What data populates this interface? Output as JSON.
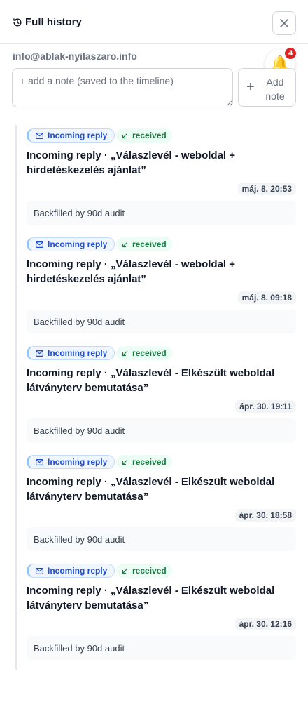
{
  "header": {
    "title": "Full history",
    "icon": "history-icon",
    "close_icon": "close-icon"
  },
  "contact": {
    "email": "info@ablak-nyilaszaro.info"
  },
  "notifications": {
    "count": "4",
    "icon": "bell-icon"
  },
  "note": {
    "placeholder": "+ add a note (saved to the timeline)",
    "add_label": "Add note",
    "add_icon": "plus-icon"
  },
  "entries": [
    {
      "type_label": "Incoming reply",
      "status_label": "received",
      "title": "Incoming reply · „Válaszlevél - weboldal + hirdetéskezelés ajánlat”",
      "time": "máj. 8. 20:53",
      "note": "Backfilled by 90d audit"
    },
    {
      "type_label": "Incoming reply",
      "status_label": "received",
      "title": "Incoming reply · „Válaszlevél - weboldal + hirdetéskezelés ajánlat”",
      "time": "máj. 8. 09:18",
      "note": "Backfilled by 90d audit"
    },
    {
      "type_label": "Incoming reply",
      "status_label": "received",
      "title": "Incoming reply · „Válaszlevél - Elkészült weboldal látványterv bemutatása”",
      "time": "ápr. 30. 19:11",
      "note": "Backfilled by 90d audit"
    },
    {
      "type_label": "Incoming reply",
      "status_label": "received",
      "title": "Incoming reply · „Válaszlevél - Elkészült weboldal látványterv bemutatása”",
      "time": "ápr. 30. 18:58",
      "note": "Backfilled by 90d audit"
    },
    {
      "type_label": "Incoming reply",
      "status_label": "received",
      "title": "Incoming reply · „Válaszlevél - Elkészült weboldal látványterv bemutatása”",
      "time": "ápr. 30. 12:16",
      "note": "Backfilled by 90d audit"
    }
  ],
  "colors": {
    "incoming": "#1d4ed8",
    "received": "#15803d",
    "badge": "#dc2626"
  }
}
